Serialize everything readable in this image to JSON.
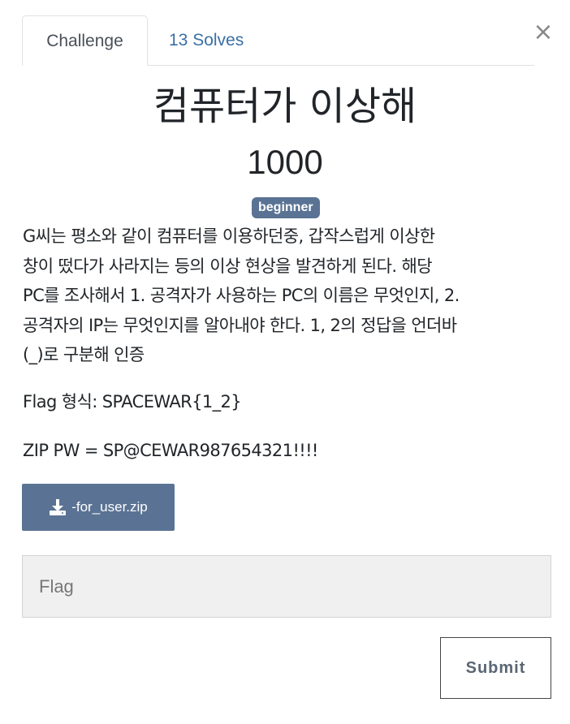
{
  "tabs": [
    {
      "label": "Challenge",
      "active": true
    },
    {
      "label": "13 Solves",
      "active": false
    }
  ],
  "close_glyph": "×",
  "challenge": {
    "title": "컴퓨터가 이상해",
    "points": "1000",
    "category_badge": "beginner",
    "description_lines": [
      "G씨는 평소와 같이 컴퓨터를 이용하던중, 갑작스럽게 이상한",
      "창이 떴다가 사라지는 등의 이상 현상을 발견하게 된다. 해당",
      "PC를 조사해서 1. 공격자가 사용하는 PC의 이름은 무엇인지, 2.",
      "공격자의 IP는 무엇인지를 알아내야 한다. 1, 2의 정답을 언더바",
      "(_)로 구분해 인증"
    ],
    "flag_format": "Flag 형식: SPACEWAR{1_2}",
    "zip_password": "ZIP PW = SP@CEWAR987654321!!!!",
    "file": {
      "label": "-for_user.zip",
      "icon": "download-icon"
    }
  },
  "form": {
    "flag_placeholder": "Flag",
    "flag_value": "",
    "submit_label": "Submit"
  },
  "colors": {
    "accent": "#5a7394",
    "link": "#3a6fa5",
    "input_bg": "#f0f0f0"
  }
}
